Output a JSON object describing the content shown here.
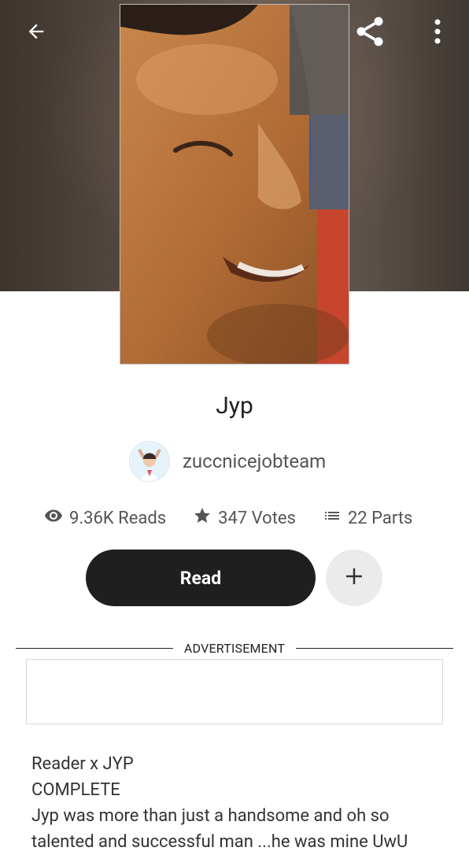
{
  "story": {
    "title": "Jyp",
    "author": "zuccnicejobteam",
    "stats": {
      "reads": "9.36K Reads",
      "votes": "347 Votes",
      "parts": "22 Parts"
    }
  },
  "actions": {
    "read_label": "Read"
  },
  "ad": {
    "label": "ADVERTISEMENT"
  },
  "description": {
    "line1": "Reader x JYP",
    "line2": "COMPLETE",
    "line3": "Jyp was more than just a handsome and oh so",
    "line4": "talented and successful man ...he was mine UwU"
  },
  "icons": {
    "back": "arrow-left-icon",
    "share": "share-icon",
    "more": "more-vert-icon",
    "reads": "eye-icon",
    "votes": "star-icon",
    "parts": "list-icon",
    "add": "plus-icon"
  },
  "colors": {
    "read_button": "#1f1f1f",
    "add_button": "#ebebeb"
  }
}
